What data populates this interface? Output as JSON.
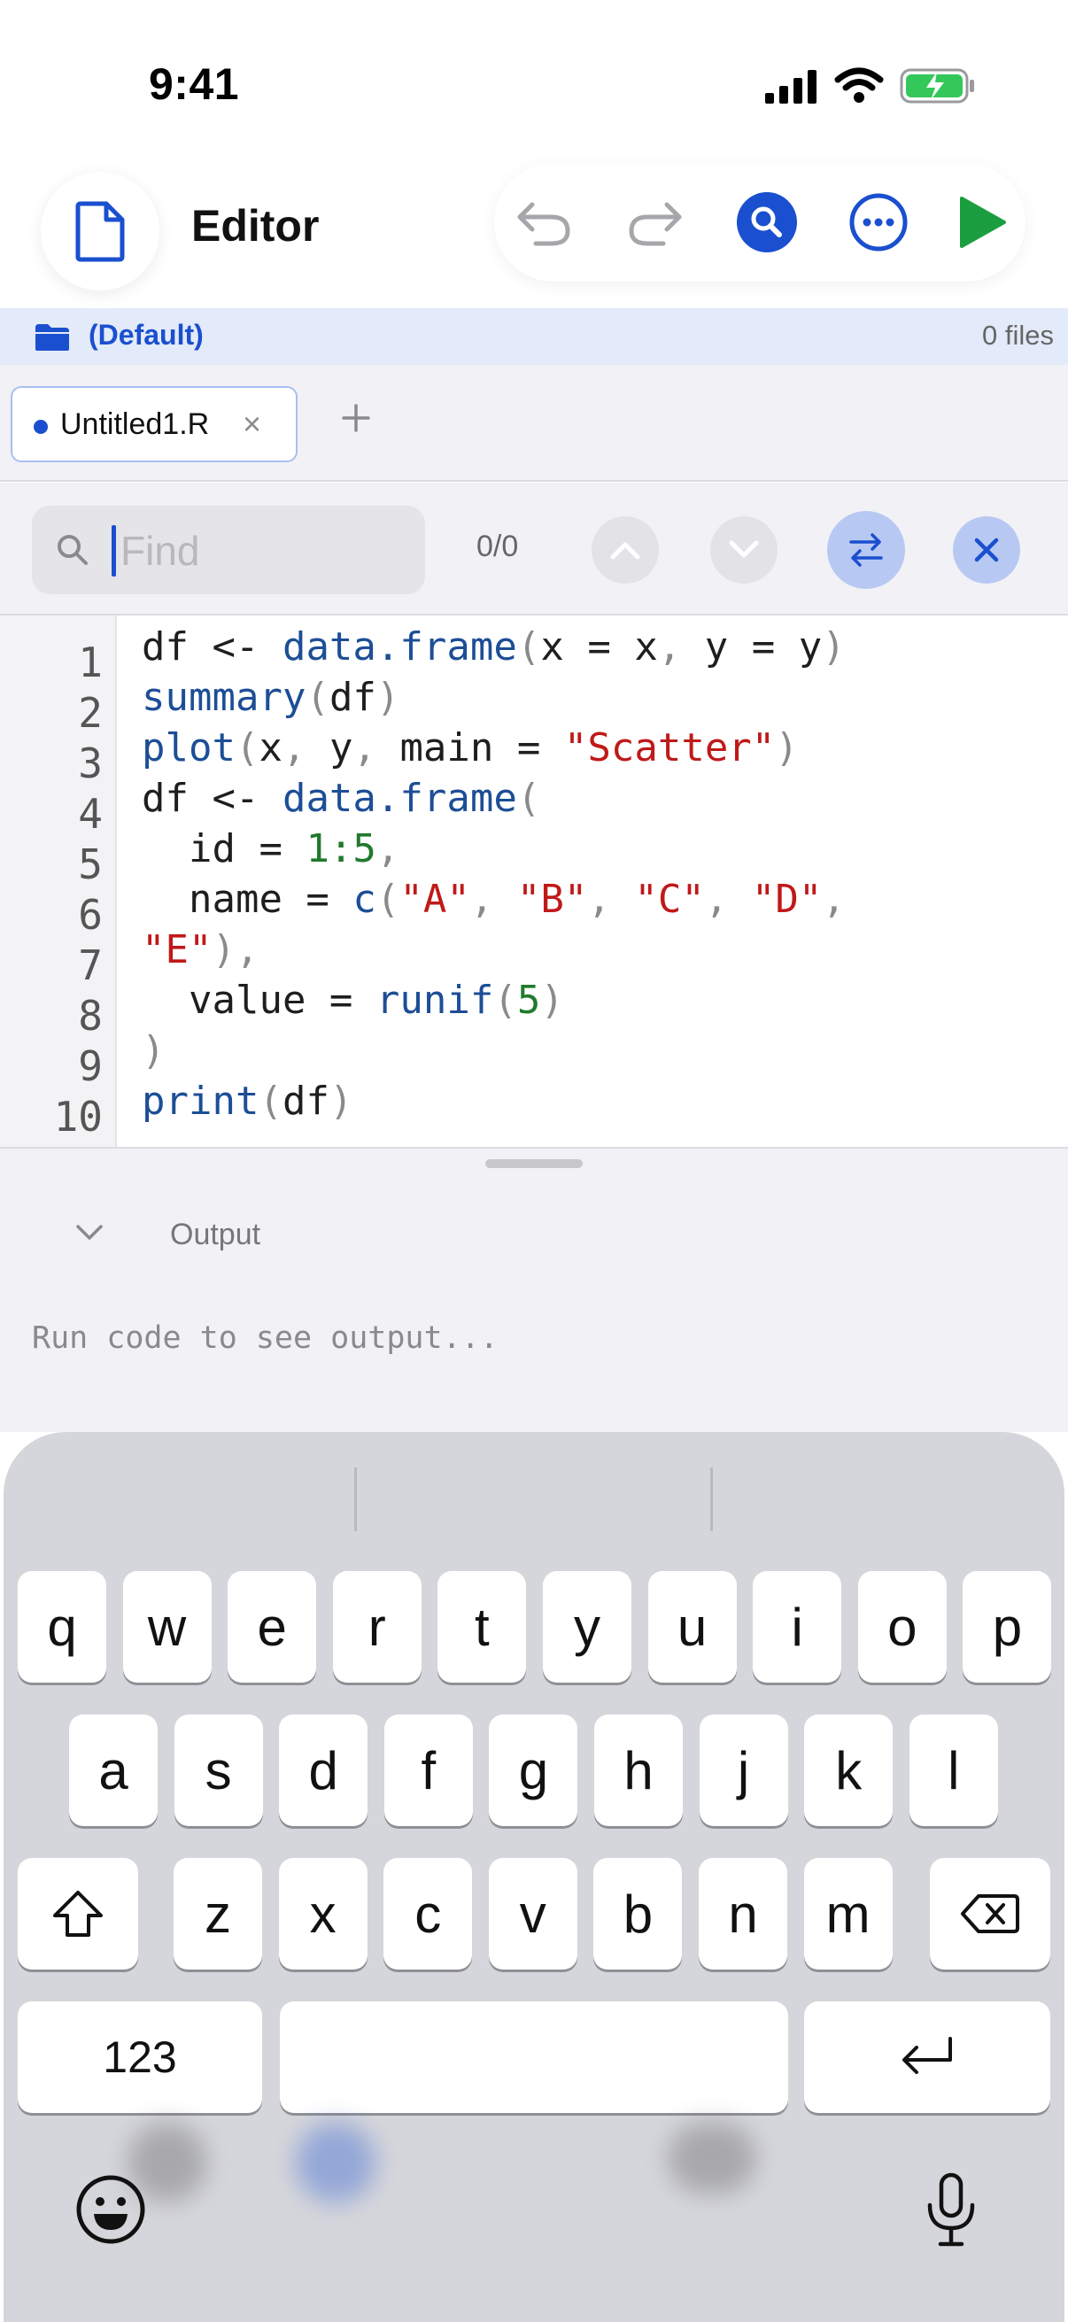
{
  "status_bar": {
    "time": "9:41"
  },
  "header": {
    "title": "Editor"
  },
  "project": {
    "name": "(Default)",
    "file_count": "0 files"
  },
  "tabs": [
    {
      "label": "Untitled1.R",
      "close": "×"
    }
  ],
  "tab_add": "+",
  "find": {
    "placeholder": "Find",
    "match_count": "0/0"
  },
  "code": {
    "line_numbers": [
      "1",
      "2",
      "3",
      "4",
      "5",
      "6",
      "7",
      "8",
      "9",
      "10"
    ],
    "lines": [
      "df <- data.frame(x = x, y = y)",
      "summary(df)",
      "plot(x, y, main = \"Scatter\")",
      "df <- data.frame(",
      "  id = 1:5,",
      "  name = c(\"A\", \"B\", \"C\", \"D\",",
      "\"E\"),",
      "  value = runif(5)",
      ")",
      "print(df)"
    ]
  },
  "output": {
    "title": "Output",
    "placeholder": "Run code to see output..."
  },
  "keyboard": {
    "row1": [
      "q",
      "w",
      "e",
      "r",
      "t",
      "y",
      "u",
      "i",
      "o",
      "p"
    ],
    "row2": [
      "a",
      "s",
      "d",
      "f",
      "g",
      "h",
      "j",
      "k",
      "l"
    ],
    "row3": [
      "z",
      "x",
      "c",
      "v",
      "b",
      "n",
      "m"
    ],
    "numbers_label": "123"
  },
  "colors": {
    "accent": "#1a4fcf",
    "run": "#1a9e3f",
    "string": "#c01919",
    "number": "#217a2c",
    "function": "#1d4e96"
  },
  "icons": [
    "cellular-signal-icon",
    "wifi-icon",
    "battery-charging-icon",
    "document-icon",
    "undo-icon",
    "redo-icon",
    "search-icon",
    "more-icon",
    "run-icon",
    "folder-icon",
    "chevron-up-icon",
    "chevron-down-icon",
    "swap-icon",
    "close-icon",
    "shift-icon",
    "delete-icon",
    "return-icon",
    "emoji-icon",
    "microphone-icon"
  ]
}
